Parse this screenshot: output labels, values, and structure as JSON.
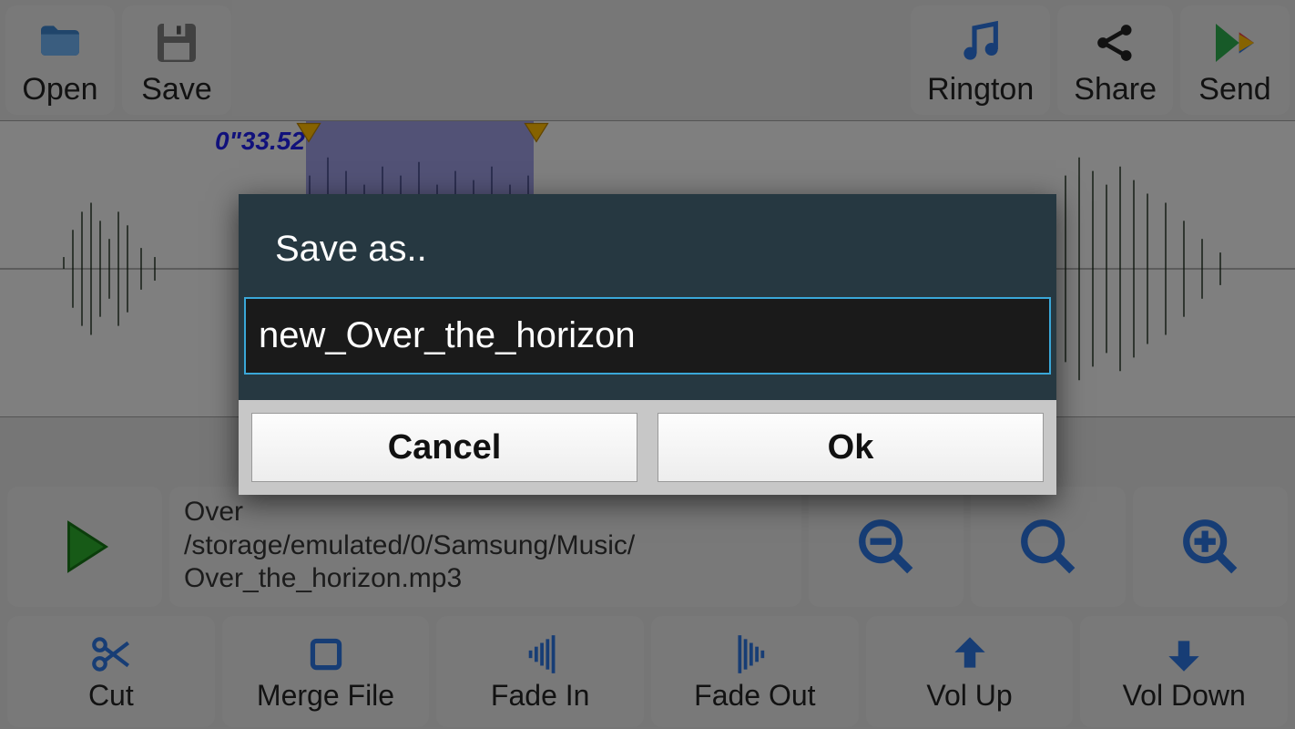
{
  "toolbar": {
    "open": "Open",
    "save": "Save",
    "ringtone": "Rington",
    "share": "Share",
    "send": "Send"
  },
  "waveform": {
    "time_label": "0\"33.52"
  },
  "file": {
    "title_line": "Over",
    "path_line1": "/storage/emulated/0/Samsung/Music/",
    "path_line2": "Over_the_horizon.mp3"
  },
  "bottom": {
    "cut": "Cut",
    "merge": "Merge File",
    "fadein": "Fade In",
    "fadeout": "Fade Out",
    "volup": "Vol Up",
    "voldown": "Vol Down"
  },
  "dialog": {
    "title": "Save as..",
    "filename": "new_Over_the_horizon",
    "cancel": "Cancel",
    "ok": "Ok"
  }
}
